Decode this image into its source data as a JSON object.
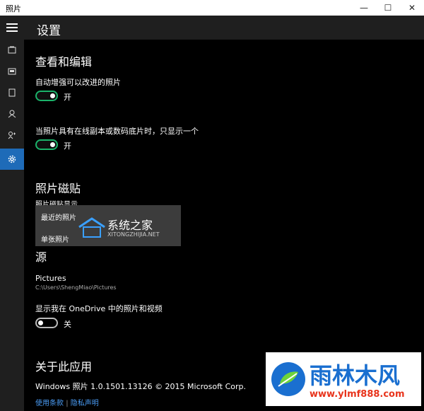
{
  "window": {
    "title": "照片",
    "min": "—",
    "max": "☐",
    "close": "✕"
  },
  "nav": {
    "items": [
      "hamburger",
      "collection",
      "albums",
      "folders",
      "people",
      "settings"
    ]
  },
  "header": {
    "title": "设置"
  },
  "view_edit": {
    "heading": "查看和编辑",
    "auto_enhance_label": "自动增强可以改进的照片",
    "auto_enhance_state": "开",
    "duplicates_label": "当照片具有在线副本或数码底片时，只显示一个",
    "duplicates_state": "开"
  },
  "tiles": {
    "heading": "照片磁贴",
    "sub_label": "照片磁贴显示",
    "options": [
      "最近的照片",
      "单张照片"
    ],
    "watermark_cn": "系统之家",
    "watermark_en": "XITONGZHIJIA.NET"
  },
  "source": {
    "heading": "源",
    "folder_name": "Pictures",
    "folder_path": "C:\\Users\\ShengMiao\\Pictures",
    "onedrive_label": "显示我在 OneDrive 中的照片和视频",
    "onedrive_state": "关"
  },
  "about": {
    "heading": "关于此应用",
    "version": "Windows 照片 1.0.1501.13126 © 2015 Microsoft Corp.",
    "terms": "使用条款",
    "divider": "|",
    "privacy": "隐私声明"
  },
  "logo": {
    "cn": "雨林木风",
    "url": "www.ylmf888.com"
  },
  "colors": {
    "accent": "#1e6bb8",
    "toggle_on": "#1bb36a",
    "link": "#4a9cf5",
    "logo_blue": "#1a6fd0"
  }
}
